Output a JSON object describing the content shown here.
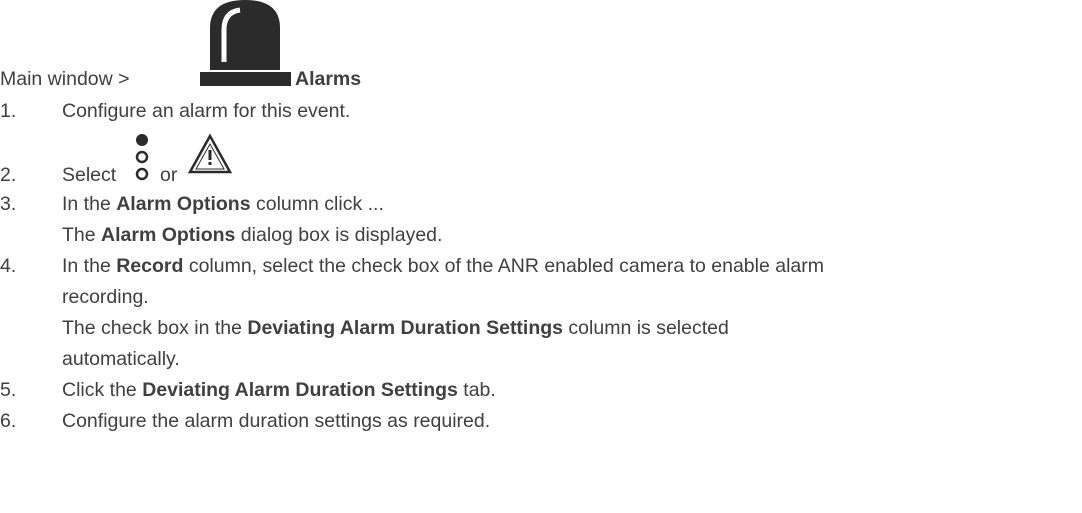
{
  "nav": {
    "prefix": "Main window >",
    "target": "Alarms",
    "icon": "alarm-siren-icon"
  },
  "steps": [
    {
      "num": "1.",
      "text": "Configure an alarm for this event."
    },
    {
      "num": "2.",
      "select": "Select",
      "or": "or",
      "icon_a": "alarm-lights-icon",
      "icon_b": "warning-triangle-icon"
    },
    {
      "num": "3.",
      "a": "In the ",
      "b": "Alarm Options",
      "c": " column click ...",
      "sub_a": "The ",
      "sub_b": "Alarm Options",
      "sub_c": " dialog box is displayed."
    },
    {
      "num": "4.",
      "a": "In the ",
      "b": "Record",
      "c": " column, select the check box of the ANR enabled camera to enable alarm",
      "d": "recording.",
      "sub_a": "The check box in the ",
      "sub_b": "Deviating Alarm Duration Settings",
      "sub_c": " column is selected",
      "sub_d": "automatically."
    },
    {
      "num": "5.",
      "a": "Click the ",
      "b": "Deviating Alarm Duration Settings",
      "c": " tab."
    },
    {
      "num": "6.",
      "text": "Configure the alarm duration settings as required."
    }
  ]
}
